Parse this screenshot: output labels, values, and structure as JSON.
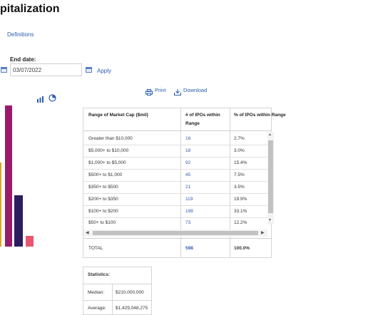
{
  "page": {
    "title": "pitalization",
    "definitions_link": "Definitions"
  },
  "filters": {
    "end_date_label": "End date:",
    "end_date_value": "03/07/2022",
    "apply_label": "Apply"
  },
  "toolbar": {
    "print_label": "Print",
    "download_label": "Download"
  },
  "chart_data": {
    "type": "bar",
    "categories": [],
    "values": [],
    "colors": [
      "#e6a21f",
      "#9b1b6b",
      "#2c1d5e",
      "#e8566f"
    ]
  },
  "table": {
    "headers": [
      "Range of Market Cap ($mil)",
      "# of IPOs within Range",
      "% of IPOs within Range"
    ],
    "rows": [
      [
        "Greater than $10,000",
        "16",
        "2.7%"
      ],
      [
        "$5,000+ to $10,000",
        "18",
        "3.0%"
      ],
      [
        "$1,000+ to $5,000",
        "92",
        "15.4%"
      ],
      [
        "$500+ to $1,000",
        "45",
        "7.5%"
      ],
      [
        "$350+ to $500",
        "21",
        "3.5%"
      ],
      [
        "$200+ to $350",
        "119",
        "19.9%"
      ],
      [
        "$100+ to $200",
        "198",
        "33.1%"
      ],
      [
        "$50+ to $100",
        "73",
        "12.2%"
      ]
    ],
    "total": [
      "TOTAL",
      "598",
      "100.0%"
    ]
  },
  "statistics": {
    "header": "Statistics:",
    "rows": [
      [
        "Median:",
        "$210,000,000"
      ],
      [
        "Average:",
        "$1,429,048,275"
      ]
    ]
  },
  "colors": {
    "accent": "#2a5db0",
    "scrollbar": "#c1c1c1"
  }
}
